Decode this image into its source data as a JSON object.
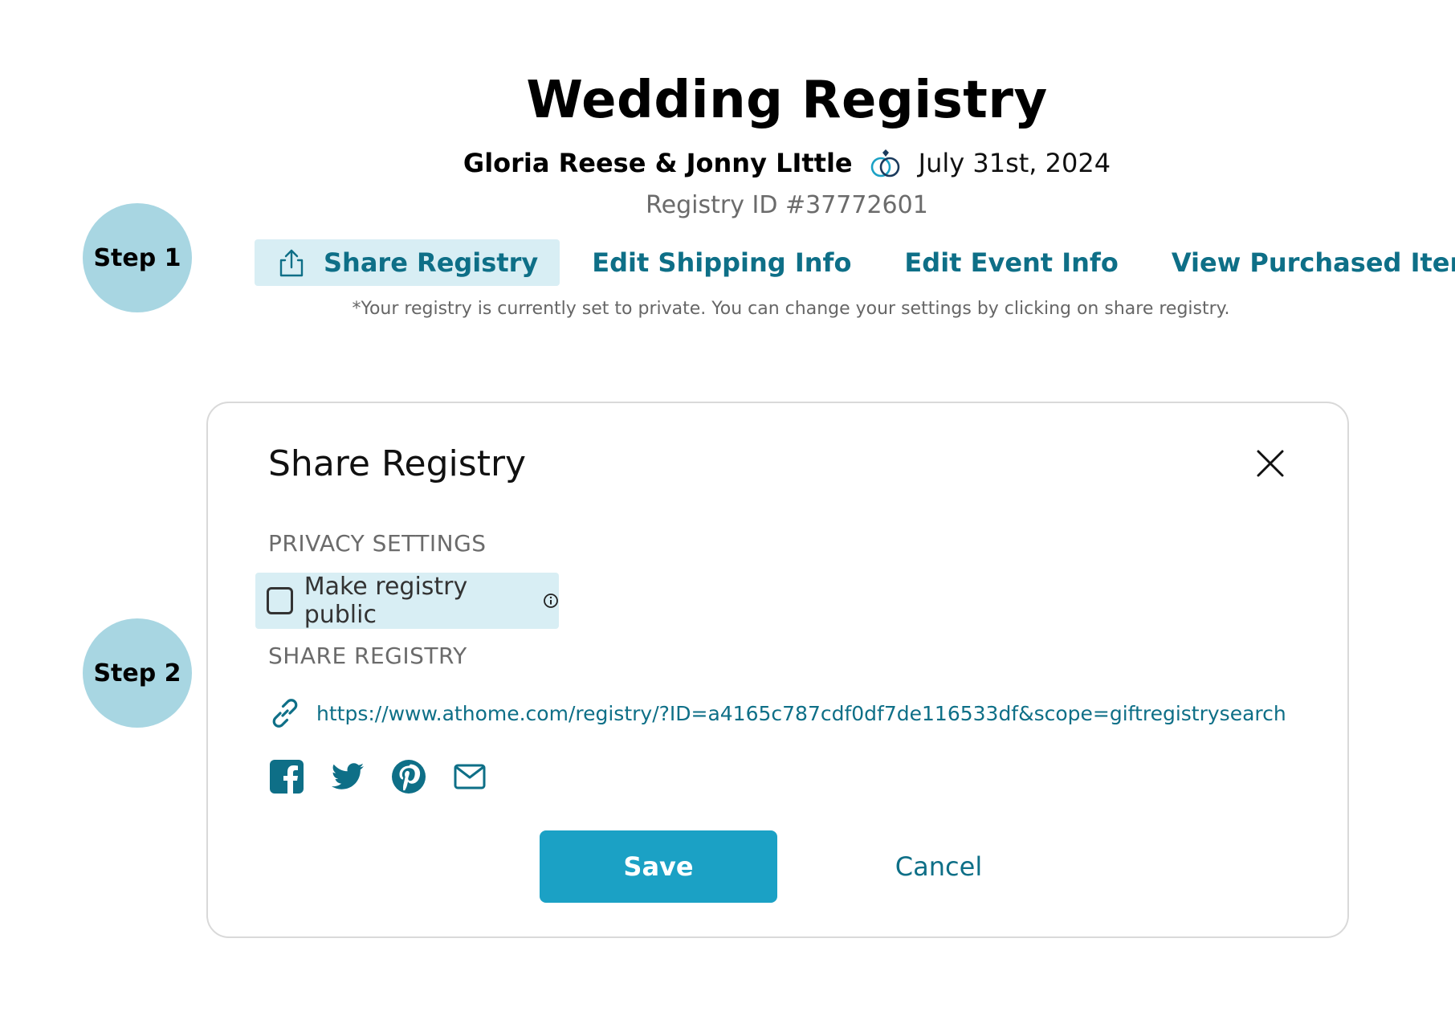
{
  "header": {
    "title": "Wedding Registry",
    "couple": "Gloria Reese & Jonny LIttle",
    "date": "July 31st, 2024",
    "registry_id": "Registry ID #37772601"
  },
  "steps": [
    "Step 1",
    "Step 2"
  ],
  "nav": {
    "items": [
      {
        "label": "Share Registry",
        "active": true,
        "icon": "share-upload-icon"
      },
      {
        "label": "Edit Shipping Info",
        "active": false
      },
      {
        "label": "Edit Event Info",
        "active": false
      },
      {
        "label": "View Purchased Items",
        "active": false
      }
    ],
    "note": "*Your registry is currently set to private. You can change your settings by clicking on share registry."
  },
  "modal": {
    "title": "Share Registry",
    "privacy_heading": "PRIVACY SETTINGS",
    "make_public_label": "Make registry public",
    "make_public_checked": false,
    "share_heading": "SHARE REGISTRY",
    "share_url": "https://www.athome.com/registry/?ID=a4165c787cdf0df7de116533df&scope=giftregistrysearch",
    "socials": [
      "facebook-icon",
      "twitter-icon",
      "pinterest-icon",
      "email-icon"
    ],
    "save_label": "Save",
    "cancel_label": "Cancel"
  },
  "colors": {
    "accent": "#0e6f87",
    "button": "#1ba1c5",
    "highlight": "#d8eef4",
    "step_circle": "#a8d6e2"
  }
}
